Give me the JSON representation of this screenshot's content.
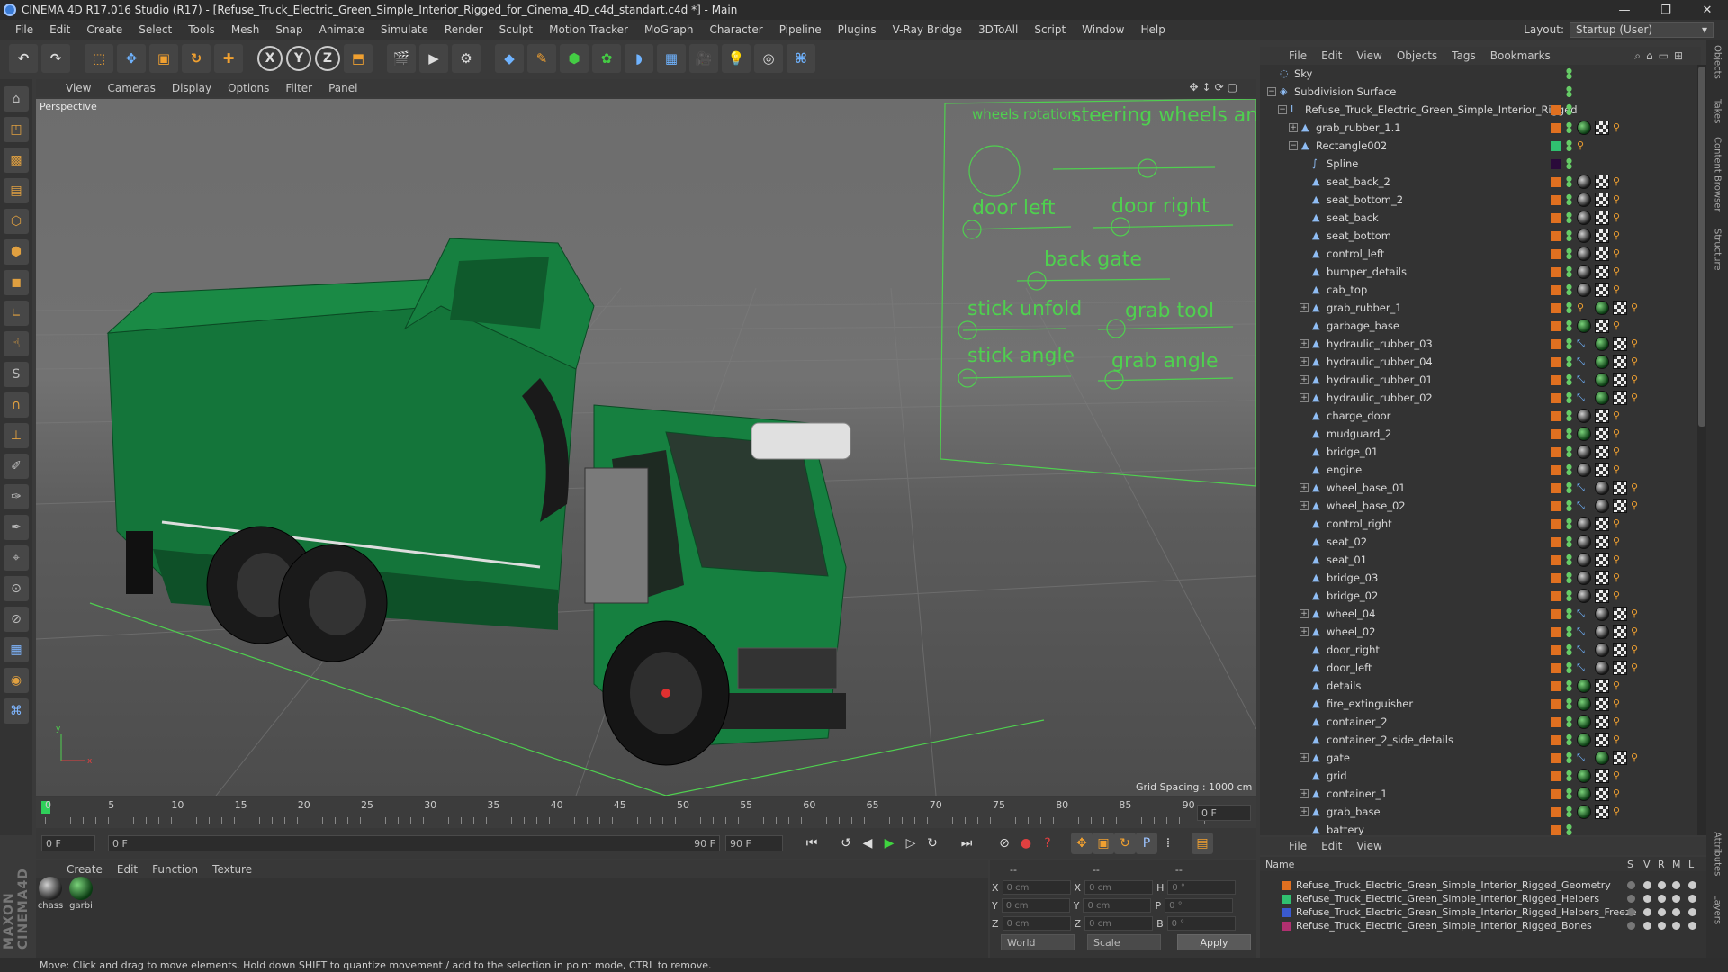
{
  "window": {
    "title": "CINEMA 4D R17.016 Studio (R17) - [Refuse_Truck_Electric_Green_Simple_Interior_Rigged_for_Cinema_4D_c4d_standart.c4d *] - Main",
    "minimize": "—",
    "maximize": "❐",
    "close": "✕"
  },
  "menu": {
    "items": [
      "File",
      "Edit",
      "Create",
      "Select",
      "Tools",
      "Mesh",
      "Snap",
      "Animate",
      "Simulate",
      "Render",
      "Sculpt",
      "Motion Tracker",
      "MoGraph",
      "Character",
      "Pipeline",
      "Plugins",
      "V-Ray Bridge",
      "3DToAll",
      "Script",
      "Window",
      "Help"
    ],
    "layout_label": "Layout:",
    "layout_value": "Startup (User)"
  },
  "toolbar": {
    "x_label": "X",
    "y_label": "Y",
    "z_label": "Z"
  },
  "viewport": {
    "menu": [
      "View",
      "Cameras",
      "Display",
      "Options",
      "Filter",
      "Panel"
    ],
    "label": "Perspective",
    "grid_spacing": "Grid Spacing : 1000 cm",
    "axis_x": "x",
    "axis_y": "y",
    "rig_controls": {
      "wheels_rotation": "wheels rotation",
      "steering": "steering wheels and turns",
      "door_left": "door left",
      "door_right": "door right",
      "back_gate": "back gate",
      "stick_unfold": "stick unfold",
      "grab_tool": "grab tool",
      "stick_angle": "stick angle",
      "grab_angle": "grab angle"
    },
    "colors": {
      "truck_green": "#14753a",
      "rig_green": "#4fd04f"
    }
  },
  "timeline": {
    "ticks": [
      "0",
      "5",
      "10",
      "15",
      "20",
      "25",
      "30",
      "35",
      "40",
      "45",
      "50",
      "55",
      "60",
      "65",
      "70",
      "75",
      "80",
      "85",
      "90"
    ],
    "current_frame_right": "0 F",
    "start_field": "0 F",
    "range_start": "0 F",
    "range_end": "90 F",
    "end_field": "90 F"
  },
  "materials": {
    "menu": [
      "Create",
      "Edit",
      "Function",
      "Texture"
    ],
    "items": [
      {
        "label": "chass",
        "kind": "grey"
      },
      {
        "label": "garbi",
        "kind": "green"
      }
    ]
  },
  "coordinates": {
    "header_left": "--",
    "header_mid": "--",
    "header_right": "--",
    "rows": [
      {
        "a": "X",
        "av": "0 cm",
        "b": "X",
        "bv": "0 cm",
        "c": "H",
        "cv": "0 °"
      },
      {
        "a": "Y",
        "av": "0 cm",
        "b": "Y",
        "bv": "0 cm",
        "c": "P",
        "cv": "0 °"
      },
      {
        "a": "Z",
        "av": "0 cm",
        "b": "Z",
        "bv": "0 cm",
        "c": "B",
        "cv": "0 °"
      }
    ],
    "world": "World",
    "scale": "Scale",
    "apply": "Apply"
  },
  "status": "Move: Click and drag to move elements. Hold down SHIFT to quantize movement / add to the selection in point mode, CTRL to remove.",
  "object_manager": {
    "menu": [
      "File",
      "Edit",
      "View",
      "Objects",
      "Tags",
      "Bookmarks"
    ],
    "objects": [
      {
        "name": "Sky",
        "indent": 0,
        "exp": "",
        "icon": "◌",
        "swatch": "",
        "tags": []
      },
      {
        "name": "Subdivision Surface",
        "indent": 0,
        "exp": "−",
        "icon": "◈",
        "swatch": "",
        "tags": []
      },
      {
        "name": "Refuse_Truck_Electric_Green_Simple_Interior_Rigged",
        "indent": 1,
        "exp": "−",
        "icon": "L",
        "swatch": "#e07020",
        "tags": []
      },
      {
        "name": "grab_rubber_1.1",
        "indent": 2,
        "exp": "+",
        "icon": "▲",
        "swatch": "#e07020",
        "tags": [
          "green",
          "check",
          "bone"
        ]
      },
      {
        "name": "Rectangle002",
        "indent": 2,
        "exp": "−",
        "icon": "▲",
        "swatch": "#30c070",
        "tags": [
          "bone"
        ]
      },
      {
        "name": "Spline",
        "indent": 3,
        "exp": "",
        "icon": "∫",
        "swatch": "#2a0a3a",
        "tags": []
      },
      {
        "name": "seat_back_2",
        "indent": 3,
        "exp": "",
        "icon": "▲",
        "swatch": "#e07020",
        "tags": [
          "grey",
          "check",
          "bone"
        ]
      },
      {
        "name": "seat_bottom_2",
        "indent": 3,
        "exp": "",
        "icon": "▲",
        "swatch": "#e07020",
        "tags": [
          "grey",
          "check",
          "bone"
        ]
      },
      {
        "name": "seat_back",
        "indent": 3,
        "exp": "",
        "icon": "▲",
        "swatch": "#e07020",
        "tags": [
          "grey",
          "check",
          "bone"
        ]
      },
      {
        "name": "seat_bottom",
        "indent": 3,
        "exp": "",
        "icon": "▲",
        "swatch": "#e07020",
        "tags": [
          "grey",
          "check",
          "bone"
        ]
      },
      {
        "name": "control_left",
        "indent": 3,
        "exp": "",
        "icon": "▲",
        "swatch": "#e07020",
        "tags": [
          "grey",
          "check",
          "bone"
        ]
      },
      {
        "name": "bumper_details",
        "indent": 3,
        "exp": "",
        "icon": "▲",
        "swatch": "#e07020",
        "tags": [
          "grey",
          "check",
          "bone"
        ]
      },
      {
        "name": "cab_top",
        "indent": 3,
        "exp": "",
        "icon": "▲",
        "swatch": "#e07020",
        "tags": [
          "grey",
          "check",
          "bone"
        ]
      },
      {
        "name": "grab_rubber_1",
        "indent": 3,
        "exp": "+",
        "icon": "▲",
        "swatch": "#e07020",
        "tags": [
          "bone",
          "green",
          "check",
          "bone"
        ]
      },
      {
        "name": "garbage_base",
        "indent": 3,
        "exp": "",
        "icon": "▲",
        "swatch": "#e07020",
        "tags": [
          "green",
          "check",
          "bone"
        ]
      },
      {
        "name": "hydraulic_rubber_03",
        "indent": 3,
        "exp": "+",
        "icon": "▲",
        "swatch": "#e07020",
        "tags": [
          "ik",
          "green",
          "check",
          "bone"
        ]
      },
      {
        "name": "hydraulic_rubber_04",
        "indent": 3,
        "exp": "+",
        "icon": "▲",
        "swatch": "#e07020",
        "tags": [
          "ik",
          "green",
          "check",
          "bone"
        ]
      },
      {
        "name": "hydraulic_rubber_01",
        "indent": 3,
        "exp": "+",
        "icon": "▲",
        "swatch": "#e07020",
        "tags": [
          "ik",
          "green",
          "check",
          "bone"
        ]
      },
      {
        "name": "hydraulic_rubber_02",
        "indent": 3,
        "exp": "+",
        "icon": "▲",
        "swatch": "#e07020",
        "tags": [
          "ik",
          "green",
          "check",
          "bone"
        ]
      },
      {
        "name": "charge_door",
        "indent": 3,
        "exp": "",
        "icon": "▲",
        "swatch": "#e07020",
        "tags": [
          "grey",
          "check",
          "bone"
        ]
      },
      {
        "name": "mudguard_2",
        "indent": 3,
        "exp": "",
        "icon": "▲",
        "swatch": "#e07020",
        "tags": [
          "green",
          "check",
          "bone"
        ]
      },
      {
        "name": "bridge_01",
        "indent": 3,
        "exp": "",
        "icon": "▲",
        "swatch": "#e07020",
        "tags": [
          "grey",
          "check",
          "bone"
        ]
      },
      {
        "name": "engine",
        "indent": 3,
        "exp": "",
        "icon": "▲",
        "swatch": "#e07020",
        "tags": [
          "grey",
          "check",
          "bone"
        ]
      },
      {
        "name": "wheel_base_01",
        "indent": 3,
        "exp": "+",
        "icon": "▲",
        "swatch": "#e07020",
        "tags": [
          "ik",
          "grey",
          "check",
          "bone"
        ]
      },
      {
        "name": "wheel_base_02",
        "indent": 3,
        "exp": "+",
        "icon": "▲",
        "swatch": "#e07020",
        "tags": [
          "ik",
          "grey",
          "check",
          "bone"
        ]
      },
      {
        "name": "control_right",
        "indent": 3,
        "exp": "",
        "icon": "▲",
        "swatch": "#e07020",
        "tags": [
          "grey",
          "check",
          "bone"
        ]
      },
      {
        "name": "seat_02",
        "indent": 3,
        "exp": "",
        "icon": "▲",
        "swatch": "#e07020",
        "tags": [
          "grey",
          "check",
          "bone"
        ]
      },
      {
        "name": "seat_01",
        "indent": 3,
        "exp": "",
        "icon": "▲",
        "swatch": "#e07020",
        "tags": [
          "grey",
          "check",
          "bone"
        ]
      },
      {
        "name": "bridge_03",
        "indent": 3,
        "exp": "",
        "icon": "▲",
        "swatch": "#e07020",
        "tags": [
          "grey",
          "check",
          "bone"
        ]
      },
      {
        "name": "bridge_02",
        "indent": 3,
        "exp": "",
        "icon": "▲",
        "swatch": "#e07020",
        "tags": [
          "grey",
          "check",
          "bone"
        ]
      },
      {
        "name": "wheel_04",
        "indent": 3,
        "exp": "+",
        "icon": "▲",
        "swatch": "#e07020",
        "tags": [
          "ik",
          "grey",
          "check",
          "bone"
        ]
      },
      {
        "name": "wheel_02",
        "indent": 3,
        "exp": "+",
        "icon": "▲",
        "swatch": "#e07020",
        "tags": [
          "ik",
          "grey",
          "check",
          "bone"
        ]
      },
      {
        "name": "door_right",
        "indent": 3,
        "exp": "",
        "icon": "▲",
        "swatch": "#e07020",
        "tags": [
          "ik",
          "grey",
          "check",
          "bone"
        ]
      },
      {
        "name": "door_left",
        "indent": 3,
        "exp": "",
        "icon": "▲",
        "swatch": "#e07020",
        "tags": [
          "ik",
          "grey",
          "check",
          "bone"
        ]
      },
      {
        "name": "details",
        "indent": 3,
        "exp": "",
        "icon": "▲",
        "swatch": "#e07020",
        "tags": [
          "green",
          "check",
          "bone"
        ]
      },
      {
        "name": "fire_extinguisher",
        "indent": 3,
        "exp": "",
        "icon": "▲",
        "swatch": "#e07020",
        "tags": [
          "green",
          "check",
          "bone"
        ]
      },
      {
        "name": "container_2",
        "indent": 3,
        "exp": "",
        "icon": "▲",
        "swatch": "#e07020",
        "tags": [
          "green",
          "check",
          "bone"
        ]
      },
      {
        "name": "container_2_side_details",
        "indent": 3,
        "exp": "",
        "icon": "▲",
        "swatch": "#e07020",
        "tags": [
          "green",
          "check",
          "bone"
        ]
      },
      {
        "name": "gate",
        "indent": 3,
        "exp": "+",
        "icon": "▲",
        "swatch": "#e07020",
        "tags": [
          "ik",
          "green",
          "check",
          "bone"
        ]
      },
      {
        "name": "grid",
        "indent": 3,
        "exp": "",
        "icon": "▲",
        "swatch": "#e07020",
        "tags": [
          "green",
          "check",
          "bone"
        ]
      },
      {
        "name": "container_1",
        "indent": 3,
        "exp": "+",
        "icon": "▲",
        "swatch": "#e07020",
        "tags": [
          "green",
          "check",
          "bone"
        ]
      },
      {
        "name": "grab_base",
        "indent": 3,
        "exp": "+",
        "icon": "▲",
        "swatch": "#e07020",
        "tags": [
          "green",
          "check",
          "bone"
        ]
      },
      {
        "name": "battery",
        "indent": 3,
        "exp": "",
        "icon": "▲",
        "swatch": "#e07020",
        "tags": []
      }
    ]
  },
  "side_tabs": [
    "Objects",
    "Takes",
    "Content Browser",
    "Structure",
    "Attributes",
    "Layers"
  ],
  "layer_manager": {
    "menu": [
      "File",
      "Edit",
      "View"
    ],
    "col_name": "Name",
    "cols": [
      "S",
      "V",
      "R",
      "M",
      "L"
    ],
    "layers": [
      {
        "name": "Refuse_Truck_Electric_Green_Simple_Interior_Rigged_Geometry",
        "color": "#e07020"
      },
      {
        "name": "Refuse_Truck_Electric_Green_Simple_Interior_Rigged_Helpers",
        "color": "#30c070"
      },
      {
        "name": "Refuse_Truck_Electric_Green_Simple_Interior_Rigged_Helpers_Freeze",
        "color": "#3a5ad0"
      },
      {
        "name": "Refuse_Truck_Electric_Green_Simple_Interior_Rigged_Bones",
        "color": "#b03070"
      }
    ]
  }
}
